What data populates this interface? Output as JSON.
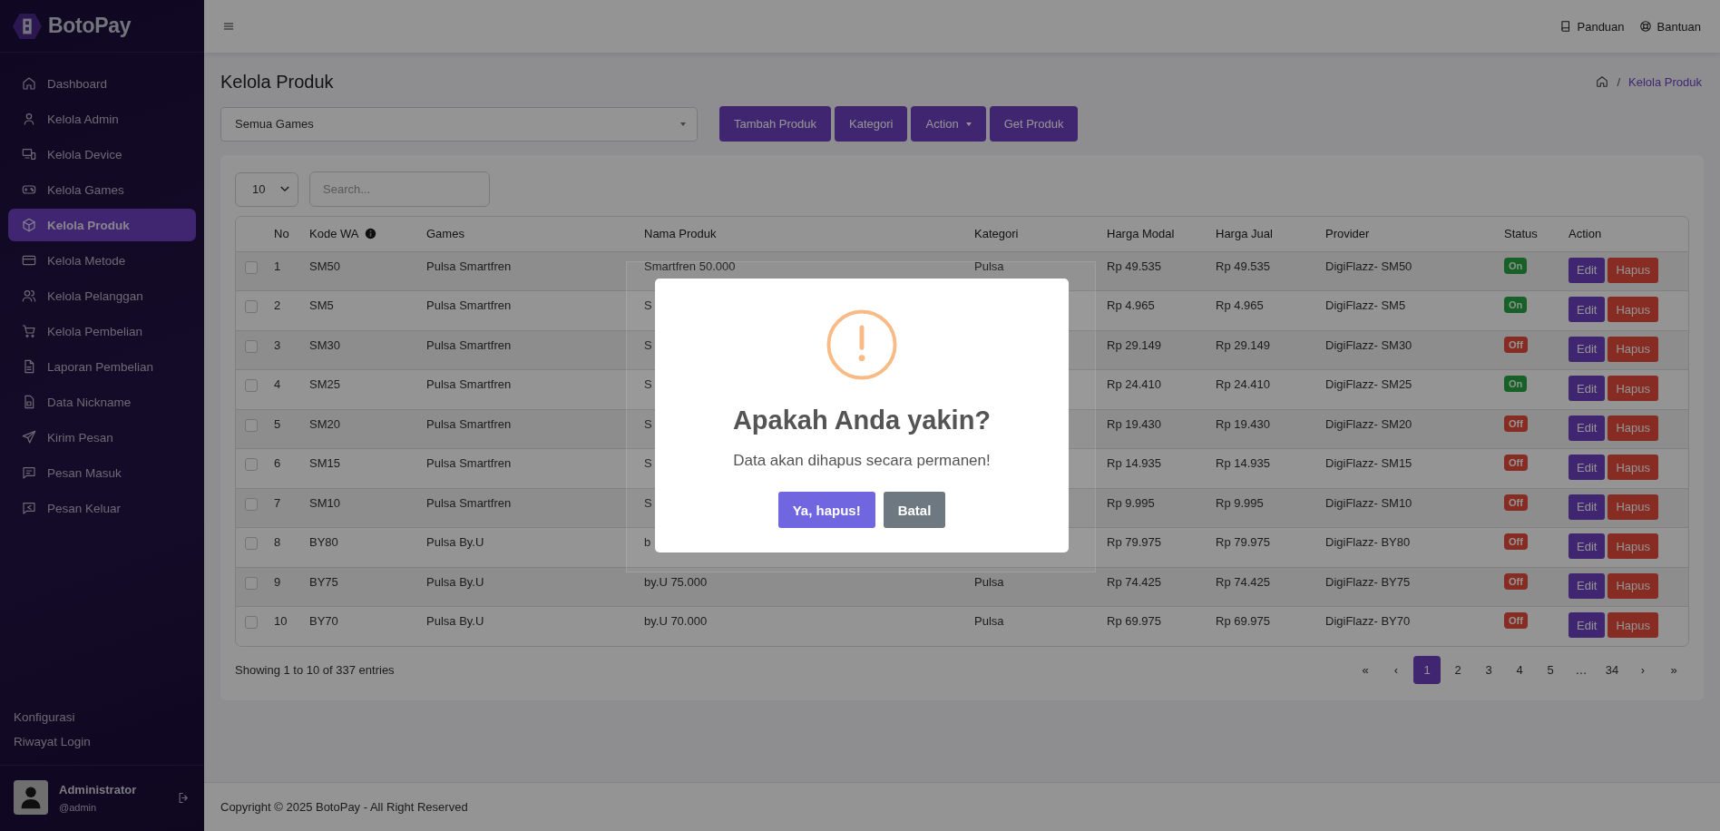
{
  "brand": {
    "name": "BotoPay"
  },
  "sidebar": {
    "items": [
      {
        "label": "Dashboard",
        "kind": "home",
        "selected": false
      },
      {
        "label": "Kelola Admin",
        "kind": "user",
        "selected": false
      },
      {
        "label": "Kelola Device",
        "kind": "device",
        "selected": false
      },
      {
        "label": "Kelola Games",
        "kind": "gamepad",
        "selected": false
      },
      {
        "label": "Kelola Produk",
        "kind": "box",
        "selected": true
      },
      {
        "label": "Kelola Metode",
        "kind": "card",
        "selected": false
      },
      {
        "label": "Kelola Pelanggan",
        "kind": "users",
        "selected": false
      },
      {
        "label": "Kelola Pembelian",
        "kind": "cart",
        "selected": false
      },
      {
        "label": "Laporan Pembelian",
        "kind": "file",
        "selected": false
      },
      {
        "label": "Data Nickname",
        "kind": "filedata",
        "selected": false
      },
      {
        "label": "Kirim Pesan",
        "kind": "send",
        "selected": false
      },
      {
        "label": "Pesan Masuk",
        "kind": "message",
        "selected": false
      },
      {
        "label": "Pesan Keluar",
        "kind": "messageout",
        "selected": false
      }
    ],
    "bottom_links": [
      "Konfigurasi",
      "Riwayat Login"
    ],
    "user": {
      "name": "Administrator",
      "handle": "@admin"
    }
  },
  "topbar": {
    "links": [
      {
        "label": "Panduan",
        "kind": "book"
      },
      {
        "label": "Bantuan",
        "kind": "lifebuoy"
      }
    ]
  },
  "page": {
    "title": "Kelola Produk",
    "breadcrumb_separator": "/",
    "breadcrumb": "Kelola Produk"
  },
  "filter": {
    "value": "Semua Games"
  },
  "toolbar_buttons": [
    {
      "label": "Tambah Produk",
      "dropdown": false
    },
    {
      "label": "Kategori",
      "dropdown": false
    },
    {
      "label": "Action",
      "dropdown": true
    },
    {
      "label": "Get Produk",
      "dropdown": false
    }
  ],
  "table": {
    "page_length": "10",
    "search": {
      "placeholder": "Search..."
    },
    "columns": [
      {
        "label": "No",
        "info": false
      },
      {
        "label": "Kode WA",
        "info": true
      },
      {
        "label": "Games",
        "info": false
      },
      {
        "label": "Nama Produk",
        "info": false
      },
      {
        "label": "Kategori",
        "info": false
      },
      {
        "label": "Harga Modal",
        "info": false
      },
      {
        "label": "Harga Jual",
        "info": false
      },
      {
        "label": "Provider",
        "info": false
      },
      {
        "label": "Status",
        "info": false
      },
      {
        "label": "Action",
        "info": false
      }
    ],
    "rows": [
      {
        "checked": false,
        "no": "1",
        "kode": "SM50",
        "games": "Pulsa Smartfren",
        "nama": "Smartfren 50.000",
        "kategori": "Pulsa",
        "modal": "Rp 49.535",
        "jual": "Rp 49.535",
        "provider": "DigiFlazz- SM50",
        "status": {
          "label": "On",
          "on": true
        },
        "actions": [
          "Edit",
          "Hapus"
        ]
      },
      {
        "checked": false,
        "no": "2",
        "kode": "SM5",
        "games": "Pulsa Smartfren",
        "nama": "S",
        "modal": "Rp 4.965",
        "jual": "Rp 4.965",
        "provider": "DigiFlazz- SM5",
        "status": {
          "label": "On",
          "on": true
        },
        "actions": [
          "Edit",
          "Hapus"
        ]
      },
      {
        "checked": false,
        "no": "3",
        "kode": "SM30",
        "games": "Pulsa Smartfren",
        "nama": "S",
        "modal": "Rp 29.149",
        "jual": "Rp 29.149",
        "provider": "DigiFlazz- SM30",
        "status": {
          "label": "Off",
          "on": false
        },
        "actions": [
          "Edit",
          "Hapus"
        ]
      },
      {
        "checked": false,
        "no": "4",
        "kode": "SM25",
        "games": "Pulsa Smartfren",
        "nama": "S",
        "modal": "Rp 24.410",
        "jual": "Rp 24.410",
        "provider": "DigiFlazz- SM25",
        "status": {
          "label": "On",
          "on": true
        },
        "actions": [
          "Edit",
          "Hapus"
        ]
      },
      {
        "checked": false,
        "no": "5",
        "kode": "SM20",
        "games": "Pulsa Smartfren",
        "nama": "S",
        "modal": "Rp 19.430",
        "jual": "Rp 19.430",
        "provider": "DigiFlazz- SM20",
        "status": {
          "label": "Off",
          "on": false
        },
        "actions": [
          "Edit",
          "Hapus"
        ]
      },
      {
        "checked": false,
        "no": "6",
        "kode": "SM15",
        "games": "Pulsa Smartfren",
        "nama": "S",
        "modal": "Rp 14.935",
        "jual": "Rp 14.935",
        "provider": "DigiFlazz- SM15",
        "status": {
          "label": "Off",
          "on": false
        },
        "actions": [
          "Edit",
          "Hapus"
        ]
      },
      {
        "checked": false,
        "no": "7",
        "kode": "SM10",
        "games": "Pulsa Smartfren",
        "nama": "S",
        "modal": "Rp 9.995",
        "jual": "Rp 9.995",
        "provider": "DigiFlazz- SM10",
        "status": {
          "label": "Off",
          "on": false
        },
        "actions": [
          "Edit",
          "Hapus"
        ]
      },
      {
        "checked": false,
        "no": "8",
        "kode": "BY80",
        "games": "Pulsa By.U",
        "nama": "b",
        "modal": "Rp 79.975",
        "jual": "Rp 79.975",
        "provider": "DigiFlazz- BY80",
        "status": {
          "label": "Off",
          "on": false
        },
        "actions": [
          "Edit",
          "Hapus"
        ]
      },
      {
        "checked": false,
        "no": "9",
        "kode": "BY75",
        "games": "Pulsa By.U",
        "nama": "by.U 75.000",
        "kategori": "Pulsa",
        "modal": "Rp 74.425",
        "jual": "Rp 74.425",
        "provider": "DigiFlazz- BY75",
        "status": {
          "label": "Off",
          "on": false
        },
        "actions": [
          "Edit",
          "Hapus"
        ]
      },
      {
        "checked": false,
        "no": "10",
        "kode": "BY70",
        "games": "Pulsa By.U",
        "nama": "by.U 70.000",
        "kategori": "Pulsa",
        "modal": "Rp 69.975",
        "jual": "Rp 69.975",
        "provider": "DigiFlazz- BY70",
        "status": {
          "label": "Off",
          "on": false
        },
        "actions": [
          "Edit",
          "Hapus"
        ]
      }
    ]
  },
  "info": "Showing 1 to 10 of 337 entries",
  "pagination": [
    {
      "label": "«",
      "selected": false
    },
    {
      "label": "‹",
      "selected": false
    },
    {
      "label": "1",
      "selected": true
    },
    {
      "label": "2",
      "selected": false
    },
    {
      "label": "3",
      "selected": false
    },
    {
      "label": "4",
      "selected": false
    },
    {
      "label": "5",
      "selected": false
    },
    {
      "label": "…",
      "selected": false
    },
    {
      "label": "34",
      "selected": false
    },
    {
      "label": "›",
      "selected": false
    },
    {
      "label": "»",
      "selected": false
    }
  ],
  "footer": "Copyright © 2025 BotoPay - All Right Reserved",
  "dialog": {
    "title": "Apakah Anda yakin?",
    "message": "Data akan dihapus secara permanen!",
    "buttons": [
      {
        "label": "Ya, hapus!",
        "kind": "confirm"
      },
      {
        "label": "Batal",
        "kind": "cancel"
      }
    ]
  }
}
